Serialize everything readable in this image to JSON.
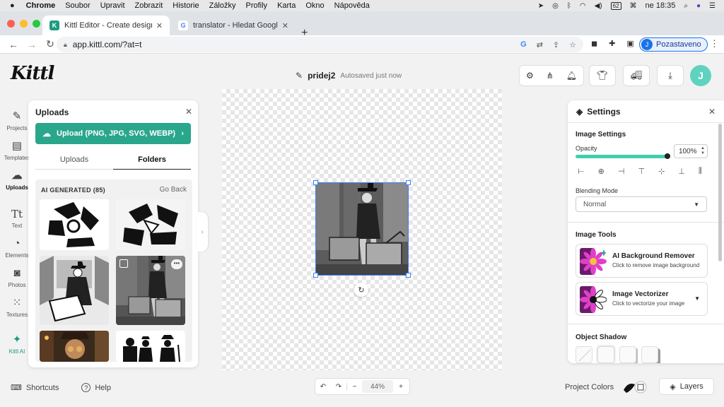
{
  "menubar": {
    "items": [
      "Chrome",
      "Soubor",
      "Upravit",
      "Zobrazit",
      "Historie",
      "Záložky",
      "Profily",
      "Karta",
      "Okno",
      "Nápověda"
    ],
    "clock": "ne 18:35",
    "battery": "62"
  },
  "browser": {
    "tabs": [
      {
        "title": "Kittl Editor - Create designs th",
        "favicon": "K",
        "favicon_color": "#1d9b7f"
      },
      {
        "title": "translator - Hledat Googlem",
        "favicon": "G",
        "favicon_color": "#4285f4"
      }
    ],
    "url": "app.kittl.com/?at=t",
    "profile_label": "Pozastaveno",
    "profile_initial": "J"
  },
  "header": {
    "logo": "Kittl",
    "file_name": "pridej2",
    "autosave": "Autosaved just now",
    "user_initial": "J"
  },
  "rail": {
    "items": [
      {
        "label": "Projects",
        "icon": "edit-square-icon"
      },
      {
        "label": "Templates",
        "icon": "template-icon"
      },
      {
        "label": "Uploads",
        "icon": "cloud-upload-icon"
      },
      {
        "label": "Text",
        "icon": "text-icon"
      },
      {
        "label": "Elements",
        "icon": "shapes-icon"
      },
      {
        "label": "Photos",
        "icon": "camera-icon"
      },
      {
        "label": "Textures",
        "icon": "texture-dots-icon"
      },
      {
        "label": "Kittl AI",
        "icon": "sparkle-icon"
      }
    ]
  },
  "uploads_panel": {
    "title": "Uploads",
    "upload_button": "Upload (PNG, JPG, SVG, WEBP)",
    "tabs": [
      "Uploads",
      "Folders"
    ],
    "active_tab": "Folders",
    "folder_title": "AI GENERATED (85)",
    "go_back": "Go Back",
    "accent_color": "#2aa68c"
  },
  "settings_panel": {
    "title": "Settings",
    "image_settings_title": "Image Settings",
    "opacity_label": "Opacity",
    "opacity_value": "100%",
    "opacity_fraction": 1.0,
    "blending_label": "Blending Mode",
    "blending_value": "Normal",
    "image_tools_title": "Image Tools",
    "tools": [
      {
        "name": "AI Background Remover",
        "desc": "Click to remove image background"
      },
      {
        "name": "Image Vectorizer",
        "desc": "Click to vectorize your image"
      }
    ],
    "object_shadow_title": "Object Shadow"
  },
  "bottom": {
    "shortcuts": "Shortcuts",
    "help": "Help",
    "zoom": "44%",
    "project_colors": "Project Colors",
    "layers": "Layers"
  }
}
